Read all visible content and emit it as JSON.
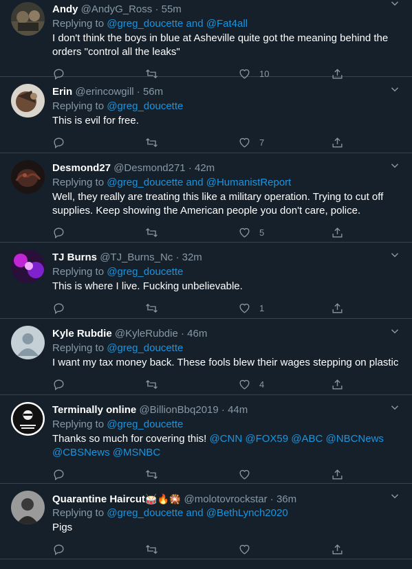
{
  "tweets": [
    {
      "name": "Andy",
      "handle": "@AndyG_Ross",
      "time": "55m",
      "replying_prefix": "Replying to",
      "replying_mentions": [
        "@greg_doucette",
        "@Fat4all"
      ],
      "text_plain": "I don't think the boys in blue at Asheville quite got the meaning behind the orders \"control all the leaks\"",
      "likes": "10",
      "avatar": "avatar-andy"
    },
    {
      "name": "Erin",
      "handle": "@erincowgill",
      "time": "56m",
      "replying_prefix": "Replying to",
      "replying_mentions": [
        "@greg_doucette"
      ],
      "text_plain": "This is evil for free.",
      "likes": "7",
      "avatar": "avatar-erin"
    },
    {
      "name": "Desmond27",
      "handle": "@Desmond271",
      "time": "42m",
      "replying_prefix": "Replying to",
      "replying_mentions": [
        "@greg_doucette",
        "@HumanistReport"
      ],
      "text_plain": "Well, they really are treating this like a military operation.  Trying to cut off supplies.  Keep showing the American people you don't care, police.",
      "likes": "5",
      "avatar": "avatar-desmond"
    },
    {
      "name": "TJ Burns",
      "handle": "@TJ_Burns_Nc",
      "time": "32m",
      "replying_prefix": "Replying to",
      "replying_mentions": [
        "@greg_doucette"
      ],
      "text_plain": "This is where I live. Fucking unbelievable.",
      "likes": "1",
      "avatar": "avatar-tj"
    },
    {
      "name": "Kyle Rubdie",
      "handle": "@KyleRubdie",
      "time": "46m",
      "replying_prefix": "Replying to",
      "replying_mentions": [
        "@greg_doucette"
      ],
      "text_plain": "I want my tax money back. These fools blew their wages stepping on plastic",
      "likes": "4",
      "avatar": "avatar-default"
    },
    {
      "name": "Terminally online",
      "handle": "@BillionBbq2019",
      "time": "44m",
      "replying_prefix": "Replying to",
      "replying_mentions": [
        "@greg_doucette"
      ],
      "text_prefix": "Thanks so much for covering this!",
      "text_mentions": [
        "@CNN",
        "@FOX59",
        "@ABC",
        "@NBCNews",
        "@CBSNews",
        "@MSNBC"
      ],
      "likes": "",
      "avatar": "avatar-terminally"
    },
    {
      "name": "Quarantine Haircut",
      "name_emoji": "🥁🔥🎇",
      "handle": "@molotovrockstar",
      "time": "36m",
      "replying_prefix": "Replying to",
      "replying_mentions": [
        "@greg_doucette",
        "@BethLynch2020"
      ],
      "text_plain": "Pigs",
      "likes": "",
      "avatar": "avatar-quarantine"
    }
  ],
  "ui": {
    "dot": "·",
    "and": "and",
    "icons": [
      "reply-icon",
      "retweet-icon",
      "like-icon",
      "share-icon",
      "caret-down-icon"
    ],
    "colors": {
      "background": "#15202b",
      "divider": "#38444d",
      "muted": "#8899a6",
      "link": "#1b95e0"
    }
  }
}
